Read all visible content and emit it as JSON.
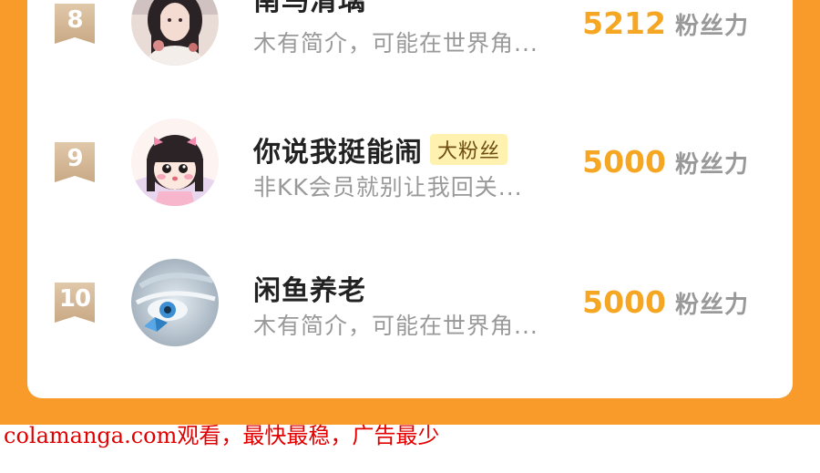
{
  "ranking": [
    {
      "rank": "8",
      "name": "南鸟清璃",
      "badge": "",
      "bio": "木有简介，可能在世界角...",
      "score": "5212",
      "score_unit": "粉丝力"
    },
    {
      "rank": "9",
      "name": "你说我挺能闹",
      "badge": "大粉丝",
      "bio": "非KK会员就别让我回关...",
      "score": "5000",
      "score_unit": "粉丝力"
    },
    {
      "rank": "10",
      "name": "闲鱼养老",
      "badge": "",
      "bio": "木有简介，可能在世界角...",
      "score": "5000",
      "score_unit": "粉丝力"
    }
  ],
  "watermark": "colamanga.com观看，最快最稳，广告最少",
  "colors": {
    "frame": "#f89b2b",
    "score": "#f5a623",
    "rank_flag": "#d4b896",
    "badge_bg": "#fff1b0"
  },
  "icons": [
    "avatar-girl-dark-hair",
    "avatar-cartoon-girl",
    "avatar-blue-eye"
  ]
}
